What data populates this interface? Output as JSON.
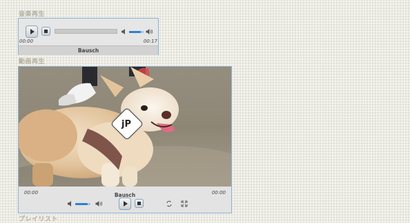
{
  "audio_section": {
    "title": "音楽再生",
    "player": {
      "current_time": "00:00",
      "duration": "00:17",
      "track_title": "Bausch",
      "progress": 0.0,
      "volume": 0.8,
      "icons": {
        "play": "play-icon",
        "stop": "stop-icon",
        "volume": "volume-icon",
        "volume_max": "volume-max-icon"
      }
    }
  },
  "video_section": {
    "title": "動画再生",
    "player": {
      "overlay_label": "jP",
      "current_time": "00:00",
      "duration": "00:00",
      "clip_title": "Bausch",
      "volume": 0.8,
      "icons": {
        "play": "play-icon",
        "stop": "stop-icon",
        "volume": "volume-icon",
        "volume_max": "volume-max-icon",
        "repeat": "repeat-icon",
        "fullscreen": "fullscreen-icon"
      }
    }
  },
  "playlist_section": {
    "title": "プレイリスト"
  }
}
